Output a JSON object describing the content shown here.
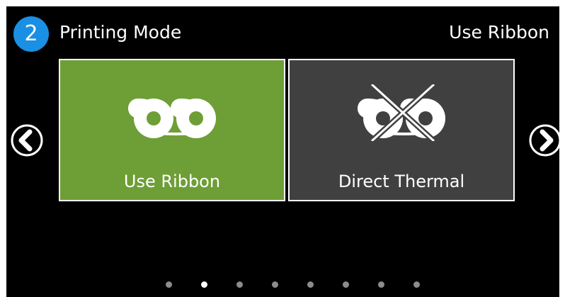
{
  "header": {
    "step_number": "2",
    "title": "Printing Mode",
    "current_value": "Use Ribbon"
  },
  "options": [
    {
      "label": "Use Ribbon",
      "icon": "ribbon-icon",
      "selected": true,
      "background": "#6e9e36"
    },
    {
      "label": "Direct Thermal",
      "icon": "ribbon-disabled-icon",
      "selected": false,
      "background": "#404040"
    }
  ],
  "navigation": {
    "prev_icon": "chevron-left-icon",
    "next_icon": "chevron-right-icon"
  },
  "pager": {
    "page_count": 8,
    "current_page": 2,
    "active_color": "#ffffff",
    "inactive_color": "#8c8c8c"
  },
  "colors": {
    "badge": "#1a8fe3",
    "background": "#000000"
  }
}
